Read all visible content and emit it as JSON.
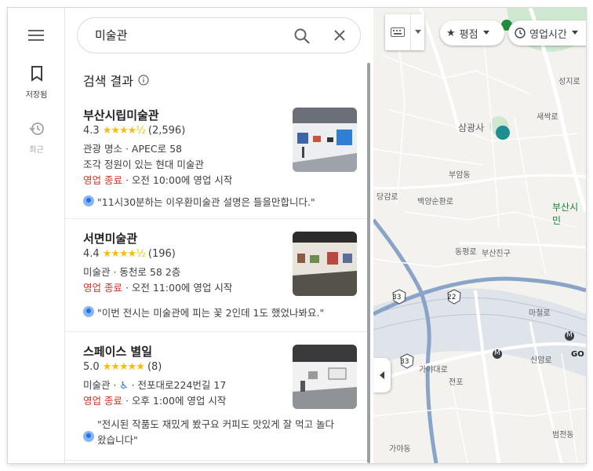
{
  "rail": {
    "saved_label": "저장됨",
    "recent_label": "최근"
  },
  "search": {
    "value": "미술관"
  },
  "results_title": "검색 결과",
  "results": [
    {
      "name": "부산시립미술관",
      "rating": "4.3",
      "stars": "★★★★½",
      "count": "(2,596)",
      "category_line": "관광 명소 · APEC로 58",
      "desc_line": "조각 정원이 있는 현대 미술관",
      "closed": "영업 종료",
      "hours": " · 오전 10:00에 영업 시작",
      "review": "\"11시30분하는 이우환미술관 설명은 들을만합니다.\""
    },
    {
      "name": "서면미술관",
      "rating": "4.4",
      "stars": "★★★★½",
      "count": "(196)",
      "category_line": "미술관 · 동천로 58 2층",
      "closed": "영업 종료",
      "hours": " · 오전 11:00에 영업 시작",
      "review": "\"이번 전시는 미술관에 피는 꽃 2인데 1도 했었나봐요.\""
    },
    {
      "name": "스페이스 별일",
      "rating": "5.0",
      "stars": "★★★★★",
      "count": "(8)",
      "category_a": "미술관 · ",
      "category_b": " · 전포대로224번길 17",
      "closed": "영업 종료",
      "hours": " · 오후 1:00에 영업 시작",
      "review_line1": "\"전시된 작품도 재밌게 봤구요 커피도 맛있게 잘 먹고 놀다",
      "review_line2": "왔습니다\""
    }
  ],
  "map": {
    "chip_rating": "평점",
    "chip_hours": "영업시간",
    "labels": {
      "samgwangsa": "삼광사",
      "busan_city": "부산시민",
      "buam": "부암동",
      "baekyang": "백양순환로",
      "dangam": "당감로",
      "dongpyeong": "동평로",
      "busanjin": "부산진구",
      "gaya": "가야대로",
      "gaya_dong": "가야동",
      "bumjeon": "범전동",
      "majang": "마철로",
      "sinam": "신암로",
      "jeonpo": "전포",
      "seongji": "성지로",
      "sanak": "새싹로",
      "route33a": "33",
      "route22": "22",
      "route33b": "33",
      "metro1": "M",
      "metro2": "M",
      "go": "GO"
    }
  }
}
